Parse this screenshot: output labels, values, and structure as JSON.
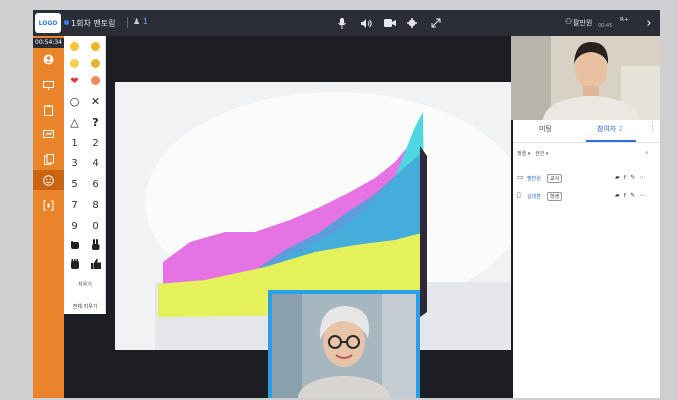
{
  "topbar": {
    "title": "1회차 멘토링",
    "people_count": "1",
    "user_name": "팔만원",
    "user_time": "00:45"
  },
  "sidebar": {
    "timer": "00:54:34"
  },
  "toolpanel": {
    "shapes": [
      "○",
      "✕",
      "△",
      "?"
    ],
    "numbers": [
      "1",
      "2",
      "3",
      "4",
      "5",
      "6",
      "7",
      "8",
      "9",
      "0"
    ],
    "erase_label": "지우기",
    "erase_all_label": "전체 지우기"
  },
  "rpanel": {
    "tab_meeting": "미팅",
    "tab_participants": "참여자",
    "tab_participants_count": "2",
    "filter_sort": "정렬 ▾",
    "filter_perm": "권한 ▾",
    "participants": [
      {
        "name": "팔만원",
        "badge": "교사"
      },
      {
        "name": "김대훈",
        "badge": "학생"
      }
    ]
  },
  "colors": {
    "sidebar": "#e9842a",
    "accent_blue": "#2a6fdb",
    "pip_border": "#2aa0e8"
  }
}
